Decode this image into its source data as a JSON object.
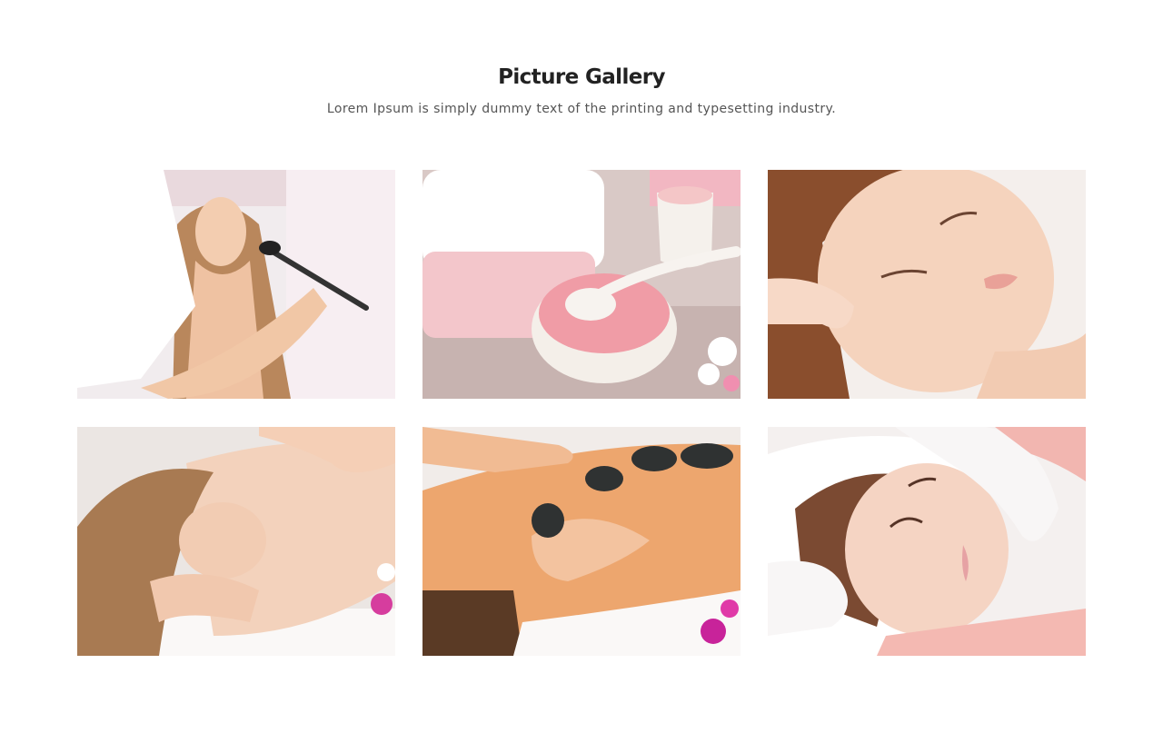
{
  "gallery": {
    "title": "Picture Gallery",
    "subtitle": "Lorem Ipsum is simply dummy text of the printing and typesetting industry."
  },
  "colors": {
    "background": "#ffffff",
    "title": "#222222",
    "subtitle": "#555555",
    "skin": "#f3c9a8",
    "hair": "#b07a4e",
    "pink": "#f2a7b2",
    "towel": "#f6f2f1"
  }
}
